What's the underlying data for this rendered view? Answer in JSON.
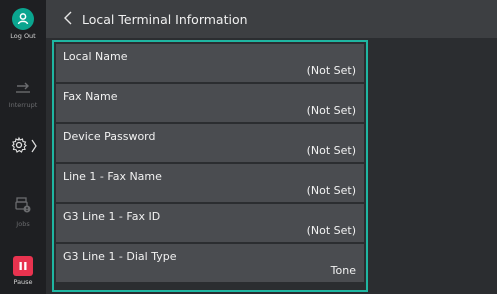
{
  "header": {
    "title": "Local Terminal Information",
    "back_icon": "chevron-left-icon"
  },
  "sidebar": {
    "logout_label": "Log Out",
    "interrupt_label": "Interrupt",
    "jobs_label": "Jobs",
    "pause_label": "Pause",
    "colors": {
      "logout": "#0aa58f",
      "pause": "#e8334f"
    }
  },
  "rows": [
    {
      "label": "Local Name",
      "value": "(Not Set)"
    },
    {
      "label": "Fax Name",
      "value": "(Not Set)"
    },
    {
      "label": "Device Password",
      "value": "(Not Set)"
    },
    {
      "label": "Line 1 - Fax Name",
      "value": "(Not Set)"
    },
    {
      "label": "G3 Line 1 - Fax ID",
      "value": "(Not Set)"
    },
    {
      "label": "G3 Line 1 - Dial Type",
      "value": "Tone"
    }
  ],
  "accent_color": "#1fb6a2"
}
